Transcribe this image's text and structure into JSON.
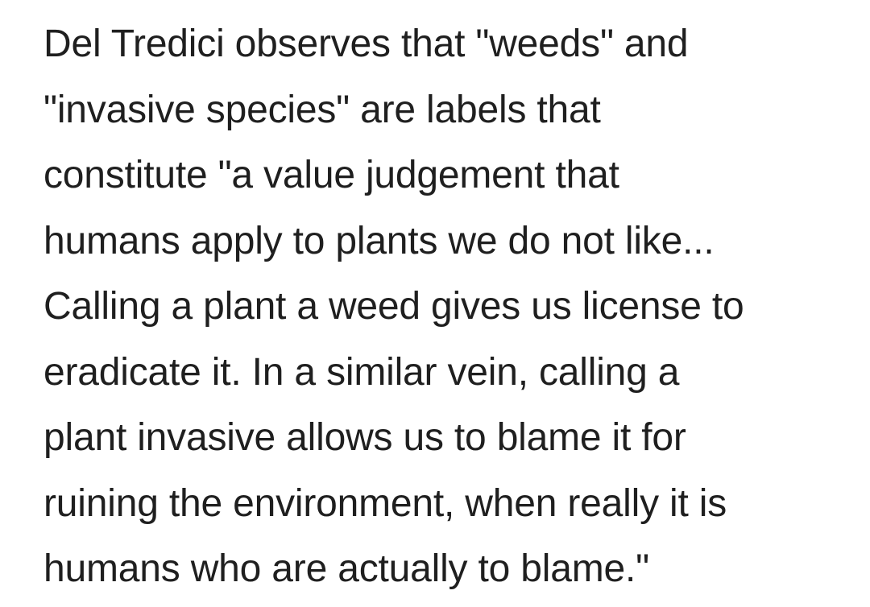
{
  "paragraph": {
    "lines": [
      "Del Tredici observes that \"weeds\" and",
      "\"invasive species\" are labels that",
      "constitute \"a value judgement that",
      "humans apply to plants we do not like...",
      "Calling a plant a weed gives us license to",
      "eradicate it. In a similar vein, calling a",
      "plant invasive allows us to blame it for",
      "ruining the environment, when really it is",
      "humans who are actually to blame.\""
    ]
  },
  "colors": {
    "text": "#1f1f1f",
    "background": "#ffffff"
  }
}
